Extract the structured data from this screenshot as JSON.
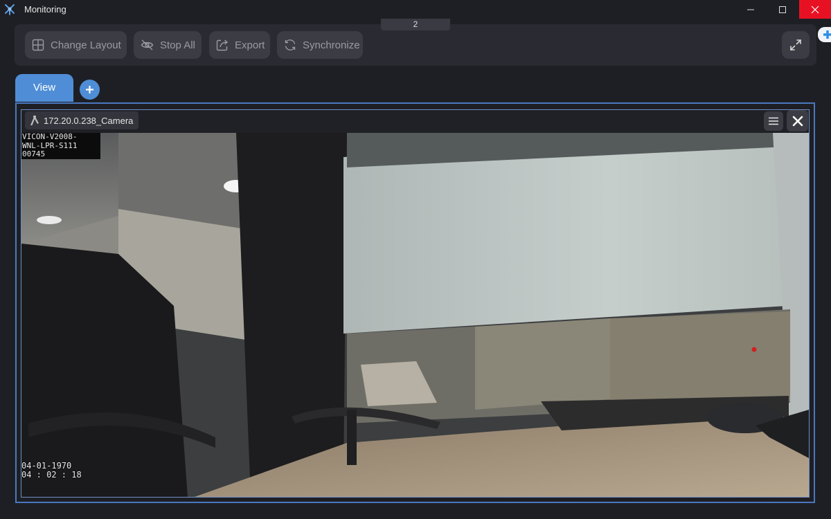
{
  "window": {
    "title": "Monitoring",
    "page_indicator": "2"
  },
  "toolbar": {
    "change_layout_label": "Change Layout",
    "stop_all_label": "Stop All",
    "export_label": "Export",
    "synchronize_label": "Synchronize"
  },
  "tabs": [
    {
      "label": "View",
      "active": true
    }
  ],
  "camera": {
    "name": "172.20.0.238_Camera",
    "osd_top": "VICON-V2008-\nWNL-LPR-S111\n00745",
    "osd_date": "04-01-1970",
    "osd_time": "04 : 02 : 18"
  },
  "colors": {
    "accent": "#4f8ed6",
    "close_hover": "#e81123",
    "background": "#1e1f24",
    "toolbar_bg": "#2a2b32",
    "button_bg": "#3c3d44"
  },
  "icons": {
    "app": "app-logo-icon",
    "layout": "grid-icon",
    "stop": "eye-off-icon",
    "export": "export-icon",
    "sync": "sync-icon",
    "fullscreen": "expand-icon",
    "camera": "camera-icon",
    "menu": "hamburger-icon",
    "close": "close-icon"
  }
}
